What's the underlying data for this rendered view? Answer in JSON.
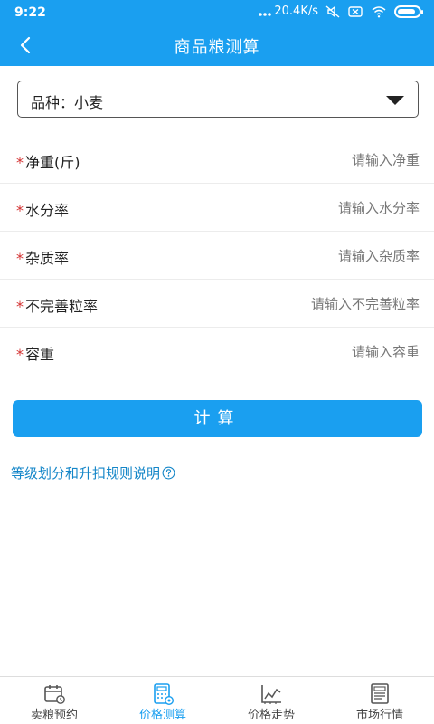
{
  "status": {
    "time": "9:22",
    "network_speed": "20.4K/s",
    "battery_level": 0.85,
    "icons": [
      "dots-icon",
      "mute-icon",
      "sim-x-icon",
      "wifi-icon",
      "battery-charging-icon"
    ]
  },
  "nav": {
    "title": "商品粮测算",
    "back_icon": "chevron-left-icon"
  },
  "variety": {
    "label": "品种：小麦",
    "caret_icon": "caret-down-icon"
  },
  "form": {
    "required_mark": "*",
    "fields": [
      {
        "label": "净重(斤)",
        "placeholder": "请输入净重"
      },
      {
        "label": "水分率",
        "placeholder": "请输入水分率"
      },
      {
        "label": "杂质率",
        "placeholder": "请输入杂质率"
      },
      {
        "label": "不完善粒率",
        "placeholder": "请输入不完善粒率"
      },
      {
        "label": "容重",
        "placeholder": "请输入容重"
      }
    ]
  },
  "calc_button": "计算",
  "rules_link": {
    "text": "等级划分和升扣规则说明",
    "icon": "help-circle-icon"
  },
  "tabs": [
    {
      "label": "卖粮预约",
      "icon": "calendar-icon",
      "active": false
    },
    {
      "label": "价格测算",
      "icon": "calculator-icon",
      "active": true
    },
    {
      "label": "价格走势",
      "icon": "trend-chart-icon",
      "active": false
    },
    {
      "label": "市场行情",
      "icon": "news-icon",
      "active": false
    }
  ],
  "colors": {
    "primary": "#1a9ff0",
    "link": "#1486c8",
    "required": "#d32f2f"
  }
}
